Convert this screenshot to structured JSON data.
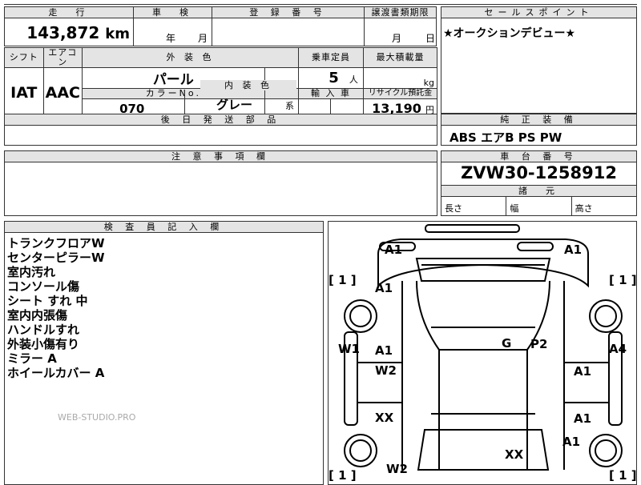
{
  "top": {
    "mileage_label": "走　行",
    "mileage_value": "143,872",
    "mileage_unit": "km",
    "shaken_label": "車　検",
    "shaken_year": "年",
    "shaken_month": "月",
    "reg_label": "登 録 番 号",
    "transfer_label": "譲渡書類期限",
    "transfer_month": "月",
    "transfer_day": "日",
    "sales_label": "セールスポイント",
    "sales_text": "★オークションデビュー★"
  },
  "spec": {
    "shift_label": "シフト",
    "shift_value": "IAT",
    "ac_label": "エアコン",
    "ac_value": "AAC",
    "exterior_label": "外 装 色",
    "exterior_value": "パール",
    "capacity_label": "乗車定員",
    "capacity_value": "5",
    "capacity_unit": "人",
    "load_label": "最大積載量",
    "load_unit": "kg",
    "color_no_label": "カラーNo.",
    "color_no_value": "070",
    "interior_label": "内 装 色",
    "interior_value": "グレー",
    "interior_suffix": "系",
    "import_label": "輸 入 車",
    "recycle_label": "リサイクル預託金",
    "recycle_value": "13,190",
    "recycle_unit": "円",
    "later_parts_label": "後 日 発 送 部 品",
    "equipment_label": "純 正 装 備",
    "equipment_value": "ABS エアB PS PW"
  },
  "caution": {
    "label": "注 意 事 項 欄"
  },
  "chassis": {
    "label": "車 台 番 号",
    "value": "ZVW30-1258912",
    "dims_label": "諸　元",
    "length_label": "長さ",
    "width_label": "幅",
    "height_label": "高さ"
  },
  "inspector": {
    "label": "検 査 員 記 入 欄",
    "notes": [
      "トランクフロアW",
      "センターピラーW",
      "室内汚れ",
      "コンソール傷",
      "シート すれ 中",
      "室内内張傷",
      "ハンドルすれ",
      "外装小傷有り",
      "ミラー A",
      "ホイールカバー A"
    ]
  },
  "watermark": "WEB-STUDIO.PRO",
  "diagram": {
    "marks": [
      "A1",
      "A1",
      "A1",
      "A1",
      "A1",
      "A1",
      "A1",
      "W1",
      "A4",
      "G",
      "P2",
      "W2",
      "XX",
      "XX",
      "W2",
      "[ 1 ]",
      "[ 1 ]",
      "[ 1 ]",
      "[ 1 ]"
    ]
  }
}
